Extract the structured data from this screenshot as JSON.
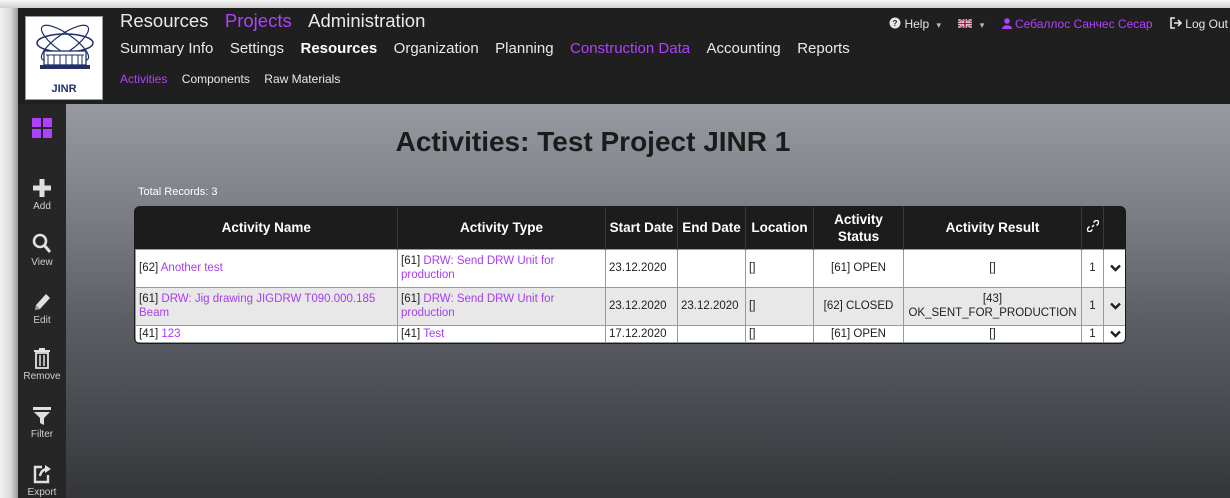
{
  "logo": {
    "text": "JINR"
  },
  "nav": {
    "top": [
      "Resources",
      "Projects",
      "Administration"
    ],
    "second": [
      "Summary Info",
      "Settings",
      "Resources",
      "Organization",
      "Planning",
      "Construction Data",
      "Accounting",
      "Reports"
    ],
    "third": [
      "Activities",
      "Components",
      "Raw Materials"
    ]
  },
  "topright": {
    "help": "Help",
    "user": "Себаллос Санчес Сесар",
    "logout": "Log Out"
  },
  "sidebar": [
    {
      "icon": "grid-icon",
      "label": ""
    },
    {
      "icon": "plus-icon",
      "label": "Add"
    },
    {
      "icon": "search-icon",
      "label": "View"
    },
    {
      "icon": "pencil-icon",
      "label": "Edit"
    },
    {
      "icon": "trash-icon",
      "label": "Remove"
    },
    {
      "icon": "filter-icon",
      "label": "Filter"
    },
    {
      "icon": "export-icon",
      "label": "Export"
    }
  ],
  "page": {
    "title": "Activities: Test Project JINR 1",
    "total_records": "Total Records: 3"
  },
  "table": {
    "headers": [
      "Activity Name",
      "Activity Type",
      "Start Date",
      "End Date",
      "Location",
      "Activity Status",
      "Activity Result",
      "",
      ""
    ],
    "rows": [
      {
        "name_id": "[62]",
        "name": "Another test",
        "type_id": "[61]",
        "type": "DRW: Send DRW Unit for production",
        "start": "23.12.2020",
        "end": "",
        "location": "[]",
        "status": "[61] OPEN",
        "result_id": "[]",
        "result": "",
        "count": "1"
      },
      {
        "name_id": "[61]",
        "name": "DRW: Jig drawing JIGDRW T090.000.185 Beam",
        "type_id": "[61]",
        "type": "DRW: Send DRW Unit for production",
        "start": "23.12.2020",
        "end": "23.12.2020",
        "location": "[]",
        "status": "[62] CLOSED",
        "result_id": "[43]",
        "result": "OK_SENT_FOR_PRODUCTION",
        "count": "1"
      },
      {
        "name_id": "[41]",
        "name": "123",
        "type_id": "[41]",
        "type": "Test",
        "start": "17.12.2020",
        "end": "",
        "location": "[]",
        "status": "[61] OPEN",
        "result_id": "[]",
        "result": "",
        "count": "1"
      }
    ]
  },
  "colors": {
    "accent": "#b040ff",
    "header_bg": "#1f1f1f",
    "table_header_bg": "#1c1c1c"
  }
}
